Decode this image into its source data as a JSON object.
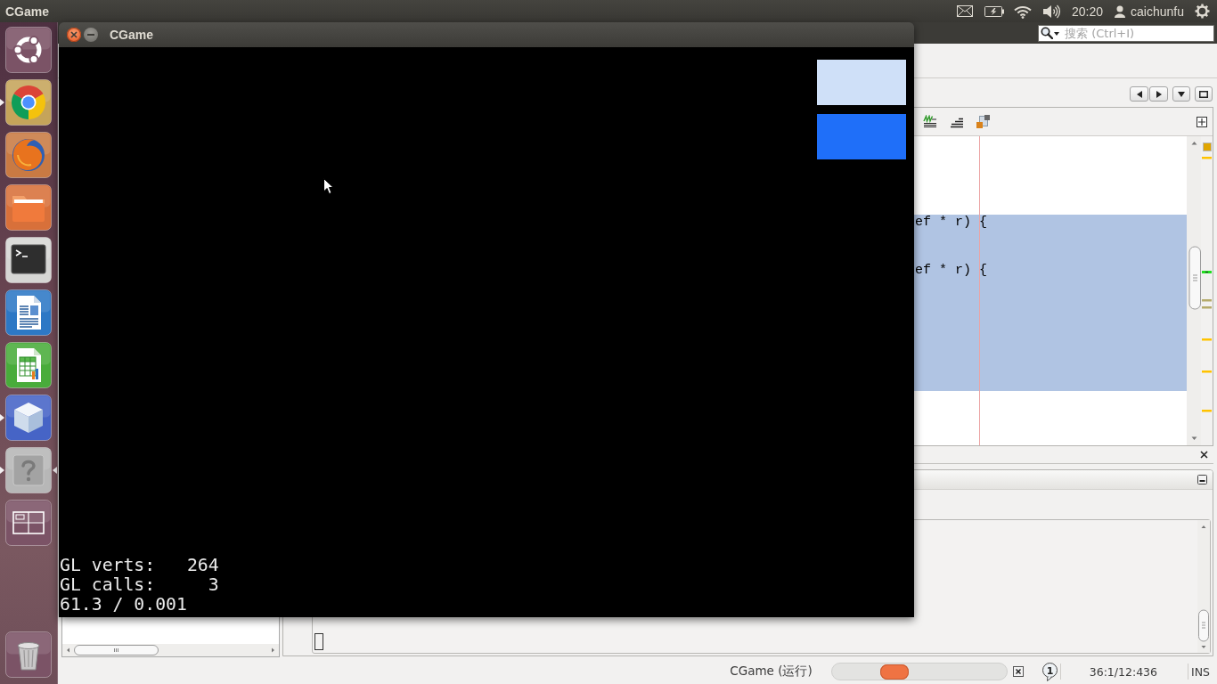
{
  "top_panel": {
    "app_title": "CGame",
    "clock": "20:20",
    "user": "caichunfu"
  },
  "launcher": {
    "items": [
      {
        "kind": "dash",
        "running": false,
        "focused": false
      },
      {
        "kind": "browser",
        "running": true,
        "focused": false
      },
      {
        "kind": "fox",
        "running": false,
        "focused": false
      },
      {
        "kind": "folder",
        "running": false,
        "focused": false
      },
      {
        "kind": "terminal",
        "running": false,
        "focused": false
      },
      {
        "kind": "document",
        "running": false,
        "focused": false
      },
      {
        "kind": "spreadsheet",
        "running": false,
        "focused": false
      },
      {
        "kind": "cube",
        "running": true,
        "focused": false
      },
      {
        "kind": "help",
        "running": true,
        "focused": true
      },
      {
        "kind": "workspaces",
        "running": false,
        "focused": false
      },
      {
        "kind": "trash",
        "running": false,
        "focused": false
      }
    ]
  },
  "game_window": {
    "title": "CGame",
    "blocks": [
      {
        "color": "#cfe0f8"
      },
      {
        "color": "#1f6ff9"
      }
    ],
    "stats": [
      "GL verts:   264",
      "GL calls:     3",
      "61.3 / 0.001"
    ]
  },
  "ide": {
    "search": {
      "placeholder": "搜索 (Ctrl+I)"
    },
    "editor": {
      "lines": [
        {
          "selected": false
        },
        {
          "selected": false
        },
        {
          "selected": false
        },
        {
          "selected": false
        },
        {
          "selected": true,
          "text": "ef * r) {"
        },
        {
          "selected": true
        },
        {
          "selected": true
        },
        {
          "selected": true,
          "text": "ef * r) {"
        },
        {
          "selected": true
        },
        {
          "selected": true
        },
        {
          "selected": true
        },
        {
          "selected": true
        },
        {
          "selected": true
        },
        {
          "selected": true
        },
        {
          "selected": true
        },
        {
          "selected": false
        },
        {
          "selected": false
        },
        {
          "selected": false
        }
      ]
    },
    "status_bar": {
      "task": "CGame (运行)",
      "progress": {
        "busy": true
      },
      "notifications": "1",
      "position": "36:1/12:436",
      "mode": "INS"
    }
  }
}
